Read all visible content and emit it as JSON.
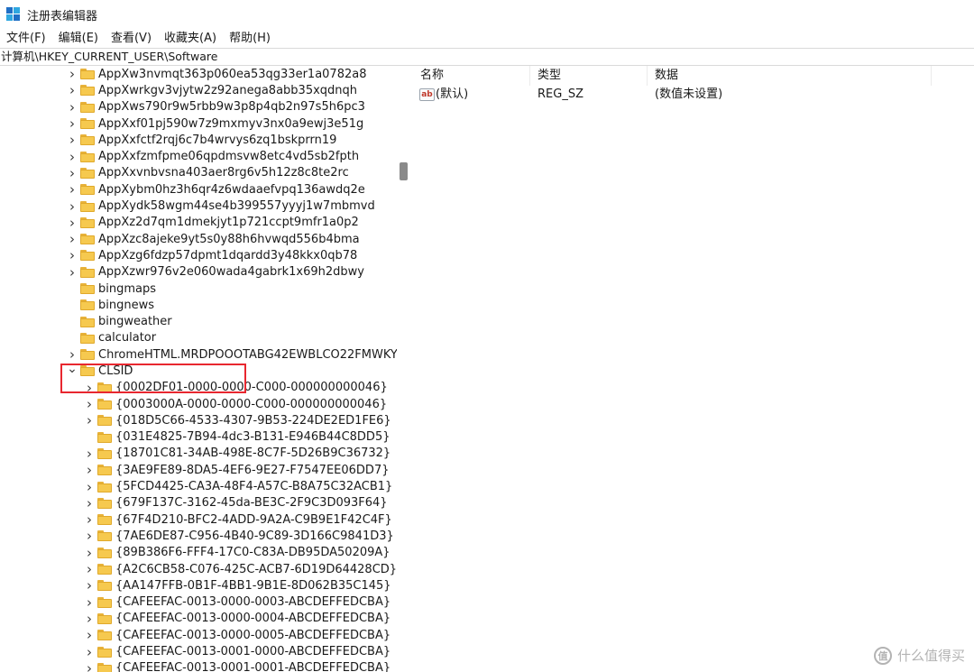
{
  "window": {
    "title": "注册表编辑器",
    "icon": "regedit-icon"
  },
  "menu": [
    "文件(F)",
    "编辑(E)",
    "查看(V)",
    "收藏夹(A)",
    "帮助(H)"
  ],
  "address": "计算机\\HKEY_CURRENT_USER\\Software",
  "tree": [
    {
      "label": "AppXw3nvmqt363p060ea53qg33er1a0782a8",
      "level": 0,
      "expand": "collapsed"
    },
    {
      "label": "AppXwrkgv3vjytw2z92anega8abb35xqdnqh",
      "level": 0,
      "expand": "collapsed"
    },
    {
      "label": "AppXws790r9w5rbb9w3p8p4qb2n97s5h6pc3",
      "level": 0,
      "expand": "collapsed"
    },
    {
      "label": "AppXxf01pj590w7z9mxmyv3nx0a9ewj3e51g",
      "level": 0,
      "expand": "collapsed"
    },
    {
      "label": "AppXxfctf2rqj6c7b4wrvys6zq1bskprrn19",
      "level": 0,
      "expand": "collapsed"
    },
    {
      "label": "AppXxfzmfpme06qpdmsvw8etc4vd5sb2fpth",
      "level": 0,
      "expand": "collapsed"
    },
    {
      "label": "AppXxvnbvsna403aer8rg6v5h12z8c8te2rc",
      "level": 0,
      "expand": "collapsed"
    },
    {
      "label": "AppXybm0hz3h6qr4z6wdaaefvpq136awdq2e",
      "level": 0,
      "expand": "collapsed"
    },
    {
      "label": "AppXydk58wgm44se4b399557yyyj1w7mbmvd",
      "level": 0,
      "expand": "collapsed"
    },
    {
      "label": "AppXz2d7qm1dmekjyt1p721ccpt9mfr1a0p2",
      "level": 0,
      "expand": "collapsed"
    },
    {
      "label": "AppXzc8ajeke9yt5s0y88h6hvwqd556b4bma",
      "level": 0,
      "expand": "collapsed"
    },
    {
      "label": "AppXzg6fdzp57dpmt1dqardd3y48kkx0qb78",
      "level": 0,
      "expand": "collapsed"
    },
    {
      "label": "AppXzwr976v2e060wada4gabrk1x69h2dbwy",
      "level": 0,
      "expand": "collapsed"
    },
    {
      "label": "bingmaps",
      "level": 0,
      "expand": "none"
    },
    {
      "label": "bingnews",
      "level": 0,
      "expand": "none"
    },
    {
      "label": "bingweather",
      "level": 0,
      "expand": "none"
    },
    {
      "label": "calculator",
      "level": 0,
      "expand": "none"
    },
    {
      "label": "ChromeHTML.MRDPOOOTABG42EWBLCO22FMWKY",
      "level": 0,
      "expand": "collapsed"
    },
    {
      "label": "CLSID",
      "level": 0,
      "expand": "expanded"
    },
    {
      "label": "{0002DF01-0000-0000-C000-000000000046}",
      "level": 1,
      "expand": "collapsed"
    },
    {
      "label": "{0003000A-0000-0000-C000-000000000046}",
      "level": 1,
      "expand": "collapsed"
    },
    {
      "label": "{018D5C66-4533-4307-9B53-224DE2ED1FE6}",
      "level": 1,
      "expand": "collapsed"
    },
    {
      "label": "{031E4825-7B94-4dc3-B131-E946B44C8DD5}",
      "level": 1,
      "expand": "none"
    },
    {
      "label": "{18701C81-34AB-498E-8C7F-5D26B9C36732}",
      "level": 1,
      "expand": "collapsed"
    },
    {
      "label": "{3AE9FE89-8DA5-4EF6-9E27-F7547EE06DD7}",
      "level": 1,
      "expand": "collapsed"
    },
    {
      "label": "{5FCD4425-CA3A-48F4-A57C-B8A75C32ACB1}",
      "level": 1,
      "expand": "collapsed"
    },
    {
      "label": "{679F137C-3162-45da-BE3C-2F9C3D093F64}",
      "level": 1,
      "expand": "collapsed"
    },
    {
      "label": "{67F4D210-BFC2-4ADD-9A2A-C9B9E1F42C4F}",
      "level": 1,
      "expand": "collapsed"
    },
    {
      "label": "{7AE6DE87-C956-4B40-9C89-3D166C9841D3}",
      "level": 1,
      "expand": "collapsed"
    },
    {
      "label": "{89B386F6-FFF4-17C0-C83A-DB95DA50209A}",
      "level": 1,
      "expand": "collapsed"
    },
    {
      "label": "{A2C6CB58-C076-425C-ACB7-6D19D64428CD}",
      "level": 1,
      "expand": "collapsed"
    },
    {
      "label": "{AA147FFB-0B1F-4BB1-9B1E-8D062B35C145}",
      "level": 1,
      "expand": "collapsed"
    },
    {
      "label": "{CAFEEFAC-0013-0000-0003-ABCDEFFEDCBA}",
      "level": 1,
      "expand": "collapsed"
    },
    {
      "label": "{CAFEEFAC-0013-0000-0004-ABCDEFFEDCBA}",
      "level": 1,
      "expand": "collapsed"
    },
    {
      "label": "{CAFEEFAC-0013-0000-0005-ABCDEFFEDCBA}",
      "level": 1,
      "expand": "collapsed"
    },
    {
      "label": "{CAFEEFAC-0013-0001-0000-ABCDEFFEDCBA}",
      "level": 1,
      "expand": "collapsed"
    },
    {
      "label": "{CAFEEFAC-0013-0001-0001-ABCDEFFEDCBA}",
      "level": 1,
      "expand": "collapsed"
    }
  ],
  "values_header": {
    "name": "名称",
    "type": "类型",
    "data": "数据"
  },
  "values": [
    {
      "name": "(默认)",
      "type": "REG_SZ",
      "data": "(数值未设置)",
      "icon": "string-value-icon"
    }
  ],
  "watermark": {
    "text": "什么值得买",
    "logo": "值"
  },
  "colors": {
    "folder": "#f6c94f",
    "highlight": "#e8272f",
    "icon_blue": "#1f6fc5",
    "icon_cyan": "#2fa7e0"
  }
}
